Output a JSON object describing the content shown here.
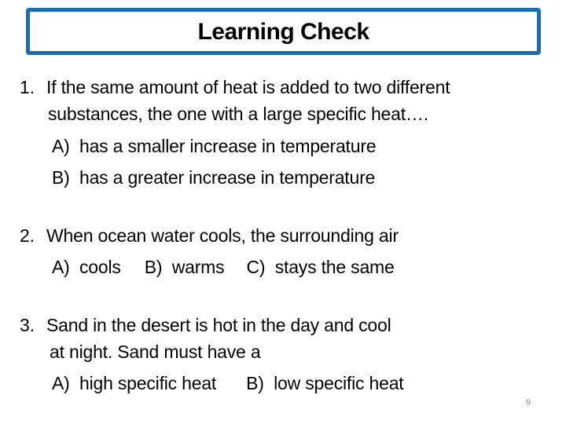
{
  "title": "Learning Check",
  "questions": [
    {
      "number": "1.",
      "lines": [
        "If the same amount of heat is added to two different",
        "substances, the one with a large specific heat…."
      ],
      "options": [
        {
          "label": "A)",
          "text": "has a smaller increase in temperature"
        },
        {
          "label": "B)",
          "text": "has a greater increase in temperature"
        }
      ]
    },
    {
      "number": "2.",
      "lines": [
        "When ocean water cools, the surrounding air"
      ],
      "options": [
        {
          "label": "A)",
          "text": "cools"
        },
        {
          "label": "B)",
          "text": "warms"
        },
        {
          "label": "C)",
          "text": "stays the same"
        }
      ]
    },
    {
      "number": "3.",
      "lines": [
        "Sand in the desert is hot in the day and cool",
        "at night. Sand must have a"
      ],
      "options": [
        {
          "label": "A)",
          "text": "high specific heat"
        },
        {
          "label": "B)",
          "text": "low specific heat"
        }
      ]
    }
  ],
  "page_number": "9"
}
